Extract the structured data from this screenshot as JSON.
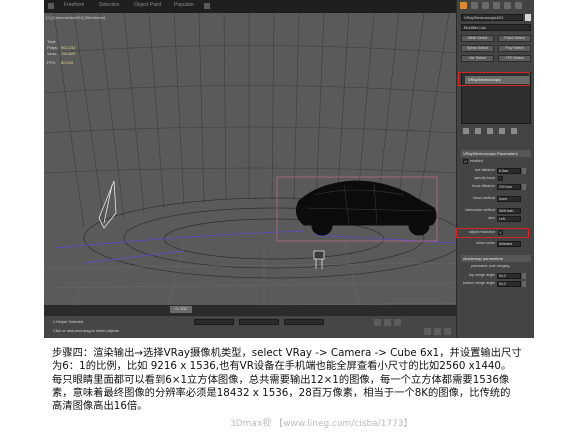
{
  "menubar": {
    "items": [
      "Freeform",
      "Selection",
      "Object Paint",
      "Populate"
    ]
  },
  "viewport": {
    "label": "[+] [CameraView001] [Wireframe]",
    "stats": [
      {
        "k": "Total",
        "v": ""
      },
      {
        "k": "Polys:",
        "v": "963,232"
      },
      {
        "k": "Verts:",
        "v": "759,822"
      },
      {
        "k": "FPS:",
        "v": "60.049"
      }
    ]
  },
  "command_panel": {
    "object_name": "VRayStereoscopic001",
    "modifier_list": "Modifier List",
    "select_buttons": [
      "Mesh Select",
      "Patch Select",
      "Spline Select",
      "Poly Select",
      "Vol. Select",
      "FFD Select"
    ],
    "stack_item": "VRayStereoscopic",
    "rollout_title": "VRayStereoscopic Parameters",
    "params": [
      {
        "label": "enabled",
        "type": "check",
        "value": "✓"
      },
      {
        "label": "eye distance",
        "type": "spinner",
        "value": "6.5cm"
      },
      {
        "label": "specify focus",
        "type": "check",
        "value": ""
      },
      {
        "label": "focus distance",
        "type": "spinner",
        "value": "200.0cm"
      },
      {
        "label": "focus method",
        "type": "dropdown",
        "value": "None"
      },
      {
        "label": "interocular method",
        "type": "dropdown",
        "value": "Shift both"
      },
      {
        "label": "view",
        "type": "dropdown",
        "value": "Left"
      },
      {
        "label": "adjust resolution",
        "type": "check",
        "value": "✓"
      },
      {
        "label": "show cones",
        "type": "dropdown",
        "value": "Selected"
      }
    ],
    "shademap_title": "shademap parameters",
    "pano_title": "panoramic pole merging",
    "pano_params": [
      {
        "label": "top merge angle",
        "value": "60.0"
      },
      {
        "label": "bottom merge angle",
        "value": "60.0"
      }
    ]
  },
  "timeline": {
    "slider": "0 / 100"
  },
  "status": {
    "line1": "1 Helper Selected",
    "line2": "Click or click-and-drag to select objects"
  },
  "caption": {
    "lines": [
      "步骤四：渲染输出→选择VRay摄像机类型，select VRay -> Camera -> Cube 6x1，并设置输出尺寸",
      "为6：1的比例，比如 9216 x 1536,也有VR设备在手机端也能全屏查看小尺寸的比如2560 x1440。",
      "每只眼睛里面都可以看到6×1立方体图像，总共需要输出12×1的图像，每一个立方体都需要1536像",
      "素，意味着最终图像的分辨率必须是18432 x 1536，28百万像素，相当于一个8K的图像，比传统的",
      "高清图像高出16倍。"
    ]
  },
  "watermark": "3Dmax视 【www.lineg.com/cisba/1773】"
}
